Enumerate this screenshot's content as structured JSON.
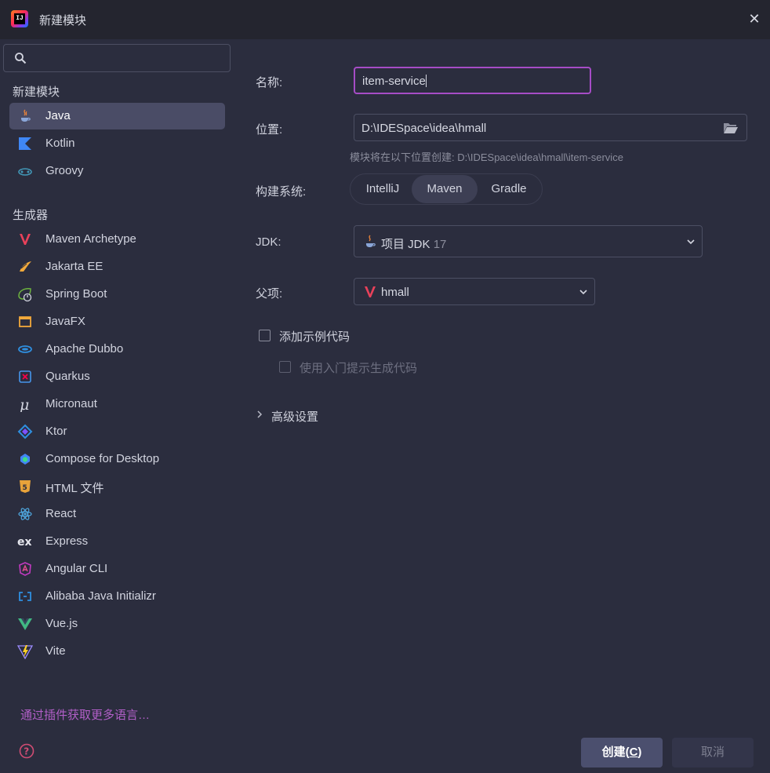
{
  "window": {
    "title": "新建模块",
    "close_icon": "close-icon"
  },
  "sidebar": {
    "search": {
      "placeholder": "",
      "value": ""
    },
    "new_module_title": "新建模块",
    "new_module_items": [
      {
        "label": "Java",
        "icon": "java-icon",
        "selected": true
      },
      {
        "label": "Kotlin",
        "icon": "kotlin-icon"
      },
      {
        "label": "Groovy",
        "icon": "groovy-icon"
      }
    ],
    "generators_title": "生成器",
    "generator_items": [
      {
        "label": "Maven Archetype",
        "icon": "maven-icon"
      },
      {
        "label": "Jakarta EE",
        "icon": "jakarta-ee-icon"
      },
      {
        "label": "Spring Boot",
        "icon": "spring-boot-icon"
      },
      {
        "label": "JavaFX",
        "icon": "javafx-icon"
      },
      {
        "label": "Apache Dubbo",
        "icon": "dubbo-icon"
      },
      {
        "label": "Quarkus",
        "icon": "quarkus-icon"
      },
      {
        "label": "Micronaut",
        "icon": "micronaut-icon"
      },
      {
        "label": "Ktor",
        "icon": "ktor-icon"
      },
      {
        "label": "Compose for Desktop",
        "icon": "compose-icon"
      },
      {
        "label": "HTML 文件",
        "icon": "html5-icon"
      },
      {
        "label": "React",
        "icon": "react-icon"
      },
      {
        "label": "Express",
        "icon": "express-icon"
      },
      {
        "label": "Angular CLI",
        "icon": "angular-icon"
      },
      {
        "label": "Alibaba Java Initializr",
        "icon": "alibaba-icon"
      },
      {
        "label": "Vue.js",
        "icon": "vue-icon"
      },
      {
        "label": "Vite",
        "icon": "vite-icon"
      }
    ],
    "plugins_link": "通过插件获取更多语言…"
  },
  "form": {
    "name_label": "名称:",
    "name_value": "item-service",
    "location_label": "位置:",
    "location_value": "D:\\IDESpace\\idea\\hmall",
    "hint_prefix": "模块将在以下位置创建: ",
    "hint_path": "D:\\IDESpace\\idea\\hmall\\item-service",
    "build_label": "构建系统:",
    "build_options": [
      "IntelliJ",
      "Maven",
      "Gradle"
    ],
    "build_selected": "Maven",
    "jdk_label": "JDK:",
    "jdk_value": "项目 JDK",
    "jdk_version": "17",
    "parent_label": "父项:",
    "parent_value": "hmall",
    "sample_code_label": "添加示例代码",
    "onboarding_label": "使用入门提示生成代码",
    "advanced_label": "高级设置"
  },
  "buttons": {
    "create_label": "创建(",
    "create_mnemonic": "C",
    "create_suffix": ")",
    "cancel_label": "取消"
  },
  "colors": {
    "accent": "#a64cc6",
    "background": "#2b2d3e",
    "titlebar": "#24252f",
    "link": "#b25fc8"
  }
}
